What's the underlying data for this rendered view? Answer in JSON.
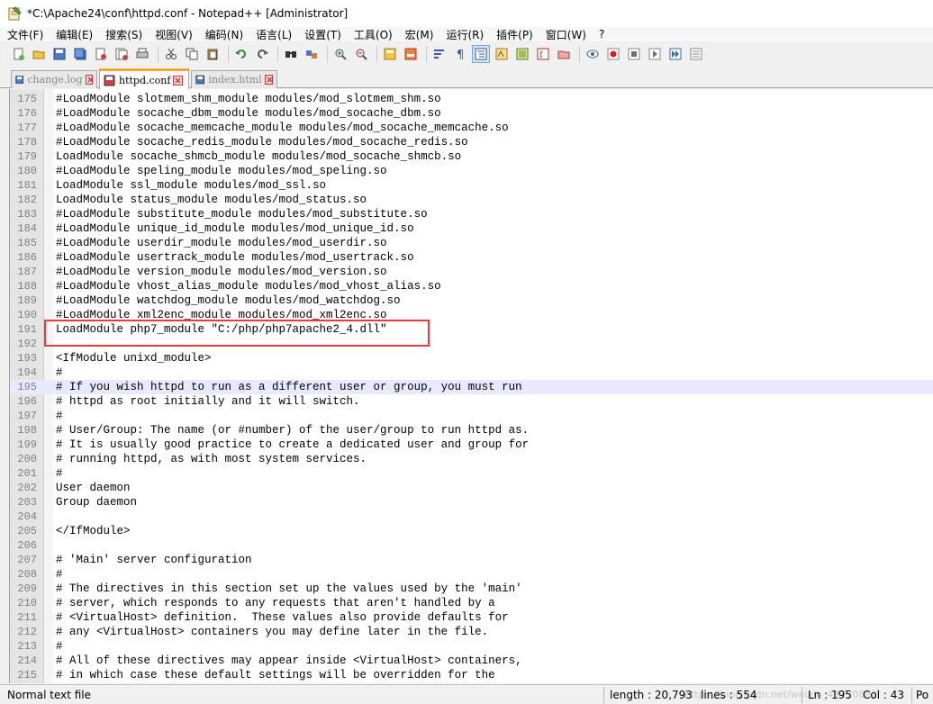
{
  "window": {
    "title": "*C:\\Apache24\\conf\\httpd.conf - Notepad++ [Administrator]"
  },
  "menu": [
    "文件(F)",
    "编辑(E)",
    "搜索(S)",
    "视图(V)",
    "编码(N)",
    "语言(L)",
    "设置(T)",
    "工具(O)",
    "宏(M)",
    "运行(R)",
    "插件(P)",
    "窗口(W)",
    "?"
  ],
  "toolbar_icons": [
    "new-file-icon",
    "open-file-icon",
    "save-icon",
    "save-all-icon",
    "close-icon",
    "close-all-icon",
    "print-icon",
    "cut-icon",
    "copy-icon",
    "paste-icon",
    "undo-icon",
    "redo-icon",
    "find-icon",
    "replace-icon",
    "zoom-in-icon",
    "zoom-out-icon",
    "sync-vertical-icon",
    "sync-horizontal-icon",
    "word-wrap-icon",
    "show-all-chars-icon",
    "indent-guide-icon",
    "user-lang-icon",
    "doc-map-icon",
    "function-list-icon",
    "folder-workspace-icon",
    "monitoring-icon",
    "record-macro-icon",
    "stop-macro-icon",
    "play-macro-icon",
    "run-macro-multiple-icon",
    "save-macro-icon"
  ],
  "tabs": [
    {
      "label": "change.log",
      "active": false,
      "icon_color": "#4a7bd0"
    },
    {
      "label": "httpd.conf",
      "active": true,
      "icon_color": "#d04040"
    },
    {
      "label": "index.html",
      "active": false,
      "icon_color": "#4a7bd0"
    }
  ],
  "editor": {
    "current_line": 195,
    "lines": [
      {
        "n": "175",
        "t": "#LoadModule slotmem_shm_module modules/mod_slotmem_shm.so"
      },
      {
        "n": "176",
        "t": "#LoadModule socache_dbm_module modules/mod_socache_dbm.so"
      },
      {
        "n": "177",
        "t": "#LoadModule socache_memcache_module modules/mod_socache_memcache.so"
      },
      {
        "n": "178",
        "t": "#LoadModule socache_redis_module modules/mod_socache_redis.so"
      },
      {
        "n": "179",
        "t": "LoadModule socache_shmcb_module modules/mod_socache_shmcb.so"
      },
      {
        "n": "180",
        "t": "#LoadModule speling_module modules/mod_speling.so"
      },
      {
        "n": "181",
        "t": "LoadModule ssl_module modules/mod_ssl.so"
      },
      {
        "n": "182",
        "t": "LoadModule status_module modules/mod_status.so"
      },
      {
        "n": "183",
        "t": "#LoadModule substitute_module modules/mod_substitute.so"
      },
      {
        "n": "184",
        "t": "#LoadModule unique_id_module modules/mod_unique_id.so"
      },
      {
        "n": "185",
        "t": "#LoadModule userdir_module modules/mod_userdir.so"
      },
      {
        "n": "186",
        "t": "#LoadModule usertrack_module modules/mod_usertrack.so"
      },
      {
        "n": "187",
        "t": "#LoadModule version_module modules/mod_version.so"
      },
      {
        "n": "188",
        "t": "#LoadModule vhost_alias_module modules/mod_vhost_alias.so"
      },
      {
        "n": "189",
        "t": "#LoadModule watchdog_module modules/mod_watchdog.so"
      },
      {
        "n": "190",
        "t": "#LoadModule xml2enc_module modules/mod_xml2enc.so"
      },
      {
        "n": "191",
        "t": "LoadModule php7_module \"C:/php/php7apache2_4.dll\""
      },
      {
        "n": "192",
        "t": ""
      },
      {
        "n": "193",
        "t": "<IfModule unixd_module>"
      },
      {
        "n": "194",
        "t": "#"
      },
      {
        "n": "195",
        "t": "# If you wish httpd to run as a different user or group, you must run"
      },
      {
        "n": "196",
        "t": "# httpd as root initially and it will switch."
      },
      {
        "n": "197",
        "t": "#"
      },
      {
        "n": "198",
        "t": "# User/Group: The name (or #number) of the user/group to run httpd as."
      },
      {
        "n": "199",
        "t": "# It is usually good practice to create a dedicated user and group for"
      },
      {
        "n": "200",
        "t": "# running httpd, as with most system services."
      },
      {
        "n": "201",
        "t": "#"
      },
      {
        "n": "202",
        "t": "User daemon"
      },
      {
        "n": "203",
        "t": "Group daemon"
      },
      {
        "n": "204",
        "t": ""
      },
      {
        "n": "205",
        "t": "</IfModule>"
      },
      {
        "n": "206",
        "t": ""
      },
      {
        "n": "207",
        "t": "# 'Main' server configuration"
      },
      {
        "n": "208",
        "t": "#"
      },
      {
        "n": "209",
        "t": "# The directives in this section set up the values used by the 'main'"
      },
      {
        "n": "210",
        "t": "# server, which responds to any requests that aren't handled by a"
      },
      {
        "n": "211",
        "t": "# <VirtualHost> definition.  These values also provide defaults for"
      },
      {
        "n": "212",
        "t": "# any <VirtualHost> containers you may define later in the file."
      },
      {
        "n": "213",
        "t": "#"
      },
      {
        "n": "214",
        "t": "# All of these directives may appear inside <VirtualHost> containers,"
      },
      {
        "n": "215",
        "t": "# in which case these default settings will be overridden for the"
      }
    ]
  },
  "status": {
    "file_type": "Normal text file",
    "length": "length : 20,793",
    "lines": "lines : 554",
    "ln": "Ln : 195",
    "col": "Col : 43",
    "pos": "Po"
  },
  "watermark": "https://blog.csdn.net/weixin_43770882"
}
